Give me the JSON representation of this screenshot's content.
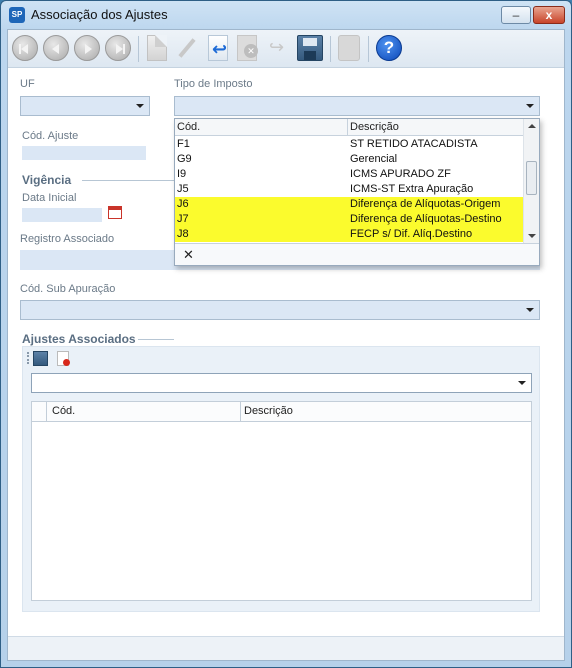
{
  "window": {
    "title": "Associação dos Ajustes",
    "app_icon_text": "SP",
    "minimize_label": "–",
    "close_label": "x"
  },
  "toolbar": {
    "buttons": [
      "first-record",
      "previous-record",
      "next-record",
      "last-record",
      "new",
      "edit",
      "undo",
      "delete",
      "redo",
      "save",
      "lock",
      "help"
    ],
    "help_label": "?"
  },
  "form": {
    "uf_label": "UF",
    "uf_value": "",
    "tipo_imposto_label": "Tipo de Imposto",
    "tipo_imposto_value": "",
    "cod_ajuste_label": "Cód. Ajuste",
    "vigencia_title": "Vigência",
    "data_inicial_label": "Data Inicial",
    "registro_associado_label": "Registro Associado",
    "cod_sub_apuracao_label": "Cód. Sub Apuração",
    "ajustes_associados_title": "Ajustes Associados"
  },
  "dropdown": {
    "columns": [
      "Cód.",
      "Descrição"
    ],
    "rows": [
      {
        "cod": "F1",
        "descricao": "ST RETIDO ATACADISTA",
        "highlight": false
      },
      {
        "cod": "G9",
        "descricao": "Gerencial",
        "highlight": false
      },
      {
        "cod": "I9",
        "descricao": "ICMS APURADO ZF",
        "highlight": false
      },
      {
        "cod": "J5",
        "descricao": "ICMS-ST Extra Apuração",
        "highlight": false
      },
      {
        "cod": "J6",
        "descricao": "Diferença de Alíquotas-Origem",
        "highlight": true
      },
      {
        "cod": "J7",
        "descricao": "Diferença de Alíquotas-Destino",
        "highlight": true
      },
      {
        "cod": "J8",
        "descricao": "FECP s/ Dif. Alíq.Destino",
        "highlight": true
      }
    ],
    "clear_label": "✕",
    "highlight_color": "#fbfb2d"
  },
  "grid": {
    "columns": [
      "Cód.",
      "Descrição"
    ],
    "rows": []
  },
  "colors": {
    "input_bg": "#dbe7f5",
    "title_bar": "#cfe3f5",
    "help_icon": "#0b47b8"
  }
}
